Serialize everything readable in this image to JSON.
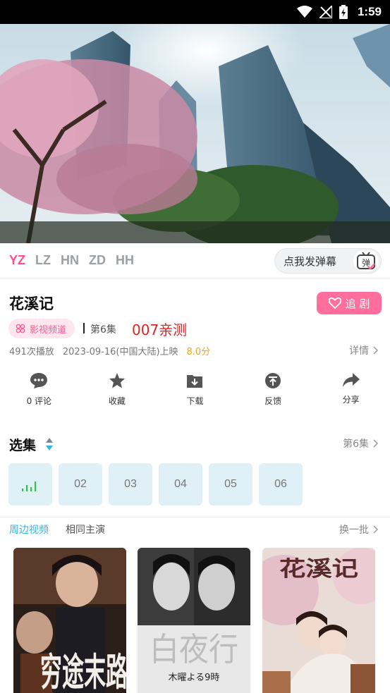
{
  "status_bar": {
    "time": "1:59"
  },
  "player": {
    "lines": [
      "YZ",
      "LZ",
      "HN",
      "ZD",
      "HH"
    ],
    "active_line": "YZ",
    "danmu_prompt": "点我发弹幕",
    "danmu_icon_text": "弹"
  },
  "show": {
    "title": "花溪记",
    "follow_label": "追 剧",
    "channel_label": "影视频道",
    "current_episode": "第6集",
    "promo_text": "007亲测",
    "plays": "491次播放",
    "release": "2023-09-16(中国大陆)上映",
    "score": "8.0分",
    "details_label": "详情"
  },
  "actions": [
    {
      "label": "0 评论",
      "icon": "comment-icon"
    },
    {
      "label": "收藏",
      "icon": "star-icon"
    },
    {
      "label": "下载",
      "icon": "download-icon"
    },
    {
      "label": "反馈",
      "icon": "feedback-icon"
    },
    {
      "label": "分享",
      "icon": "share-icon"
    }
  ],
  "episodes": {
    "section_title": "选集",
    "current_label": "第6集",
    "items": [
      "",
      "02",
      "03",
      "04",
      "05",
      "06"
    ]
  },
  "related": {
    "tabs": [
      "周边视频",
      "相同主演"
    ],
    "refresh_label": "换一批",
    "posters": [
      {
        "title_text": "穷途末路"
      },
      {
        "title_text": "白夜行",
        "caption": "木曜よる9時"
      },
      {
        "title_text": "花溪记"
      }
    ]
  },
  "colors": {
    "accent_pink": "#ff6e9c",
    "accent_blue": "#2fb5e0",
    "promo_red": "#e02424",
    "score_orange": "#f0a41f"
  }
}
